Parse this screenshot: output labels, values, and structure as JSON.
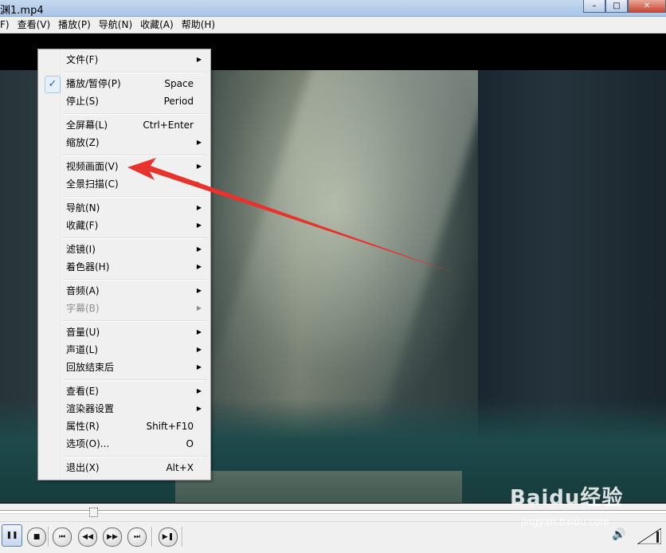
{
  "window": {
    "title": "渊1.mp4",
    "buttons": [
      "–",
      "□",
      "✕"
    ]
  },
  "menubar": {
    "items": [
      {
        "label": "F)"
      },
      {
        "label": "查看(V)"
      },
      {
        "label": "播放(P)"
      },
      {
        "label": "导航(N)"
      },
      {
        "label": "收藏(A)"
      },
      {
        "label": "帮助(H)"
      }
    ]
  },
  "context_menu": {
    "items": [
      {
        "label": "文件(F)",
        "shortcut": "",
        "submenu": true
      },
      {
        "label": "播放/暂停(P)",
        "shortcut": "Space",
        "checked": true
      },
      {
        "label": "停止(S)",
        "shortcut": "Period"
      },
      {
        "label": "全屏幕(L)",
        "shortcut": "Ctrl+Enter"
      },
      {
        "label": "缩放(Z)",
        "shortcut": "",
        "submenu": true
      },
      {
        "label": "视频画面(V)",
        "shortcut": "",
        "submenu": true
      },
      {
        "label": "全景扫描(C)",
        "shortcut": "",
        "submenu": true
      },
      {
        "label": "导航(N)",
        "shortcut": "",
        "submenu": true
      },
      {
        "label": "收藏(F)",
        "shortcut": "",
        "submenu": true
      },
      {
        "label": "滤镜(I)",
        "shortcut": "",
        "submenu": true
      },
      {
        "label": "着色器(H)",
        "shortcut": "",
        "submenu": true
      },
      {
        "label": "音频(A)",
        "shortcut": "",
        "submenu": true
      },
      {
        "label": "字幕(B)",
        "shortcut": "",
        "submenu": true,
        "disabled": true
      },
      {
        "label": "音量(U)",
        "shortcut": "",
        "submenu": true
      },
      {
        "label": "声道(L)",
        "shortcut": "",
        "submenu": true
      },
      {
        "label": "回放结束后",
        "shortcut": "",
        "submenu": true
      },
      {
        "label": "查看(E)",
        "shortcut": "",
        "submenu": true
      },
      {
        "label": "渲染器设置",
        "shortcut": "",
        "submenu": true
      },
      {
        "label": "属性(R)",
        "shortcut": "Shift+F10"
      },
      {
        "label": "选项(O)...",
        "shortcut": "O"
      },
      {
        "label": "退出(X)",
        "shortcut": "Alt+X"
      }
    ],
    "check_mark": "✓",
    "submenu_glyph": "▶"
  },
  "player": {
    "seek_position": 0.14,
    "controls": [
      {
        "name": "pause",
        "glyph": "❚❚"
      },
      {
        "name": "stop",
        "glyph": "■"
      },
      {
        "name": "prev",
        "glyph": "⏮"
      },
      {
        "name": "rewind",
        "glyph": "◀◀"
      },
      {
        "name": "forward",
        "glyph": "▶▶"
      },
      {
        "name": "next",
        "glyph": "⏭"
      },
      {
        "name": "frame-step",
        "glyph": "▶❚"
      }
    ],
    "speaker_glyph": "🔊"
  },
  "watermark": {
    "brand": "Baidu经验",
    "url": "jingyan.baidu.com"
  },
  "colors": {
    "annotation_arrow": "#e8322c"
  }
}
